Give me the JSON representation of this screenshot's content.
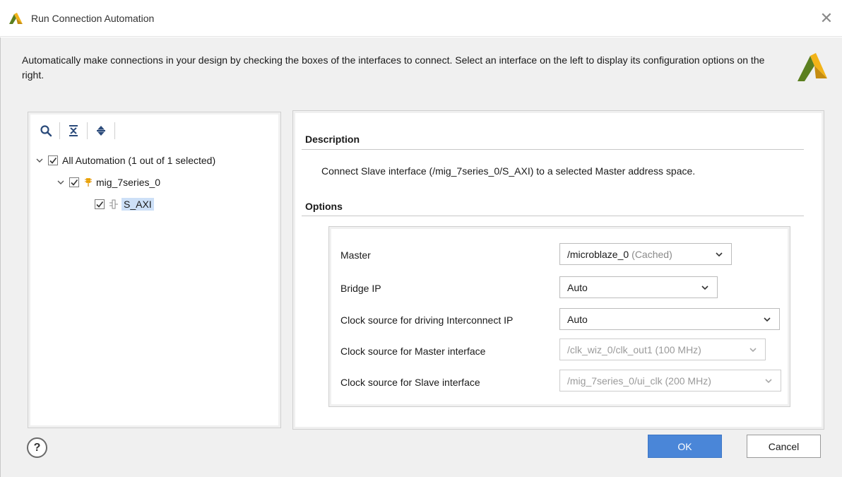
{
  "window": {
    "title": "Run Connection Automation",
    "close_glyph": "✕",
    "icon": "xilinx-logo-icon"
  },
  "intro_text": "Automatically make connections in your design by checking the boxes of the interfaces to connect. Select an interface on the left to display its configuration options on the right.",
  "toolbar": {
    "icons": [
      "search-icon",
      "collapse-all-icon",
      "expand-all-icon"
    ]
  },
  "tree": {
    "root": {
      "label": "All Automation (1 out of 1 selected)",
      "checked": true,
      "expanded": true
    },
    "child": {
      "label": "mig_7series_0",
      "checked": true,
      "expanded": true,
      "icon": "ip-block-icon"
    },
    "leaf": {
      "label": "S_AXI",
      "checked": true,
      "selected": true,
      "icon": "bus-interface-icon"
    }
  },
  "description": {
    "title": "Description",
    "text": "Connect Slave interface (/mig_7series_0/S_AXI) to a selected Master address space."
  },
  "options": {
    "title": "Options",
    "rows": [
      {
        "label": "Master",
        "value": "/microblaze_0",
        "note": "(Cached)",
        "enabled": true
      },
      {
        "label": "Bridge IP",
        "value": "Auto",
        "note": "",
        "enabled": true
      },
      {
        "label": "Clock source for driving Interconnect IP",
        "value": "Auto",
        "note": "",
        "enabled": true
      },
      {
        "label": "Clock source for Master interface",
        "value": "/clk_wiz_0/clk_out1 (100 MHz)",
        "note": "",
        "enabled": false
      },
      {
        "label": "Clock source for Slave interface",
        "value": "/mig_7series_0/ui_clk (200 MHz)",
        "note": "",
        "enabled": false
      }
    ]
  },
  "buttons": {
    "help": "?",
    "ok": "OK",
    "cancel": "Cancel"
  },
  "colors": {
    "accent": "#4a86d8",
    "selection": "#cde0f7",
    "logo_green": "#5b7f1f",
    "logo_yellow": "#f2b318"
  }
}
